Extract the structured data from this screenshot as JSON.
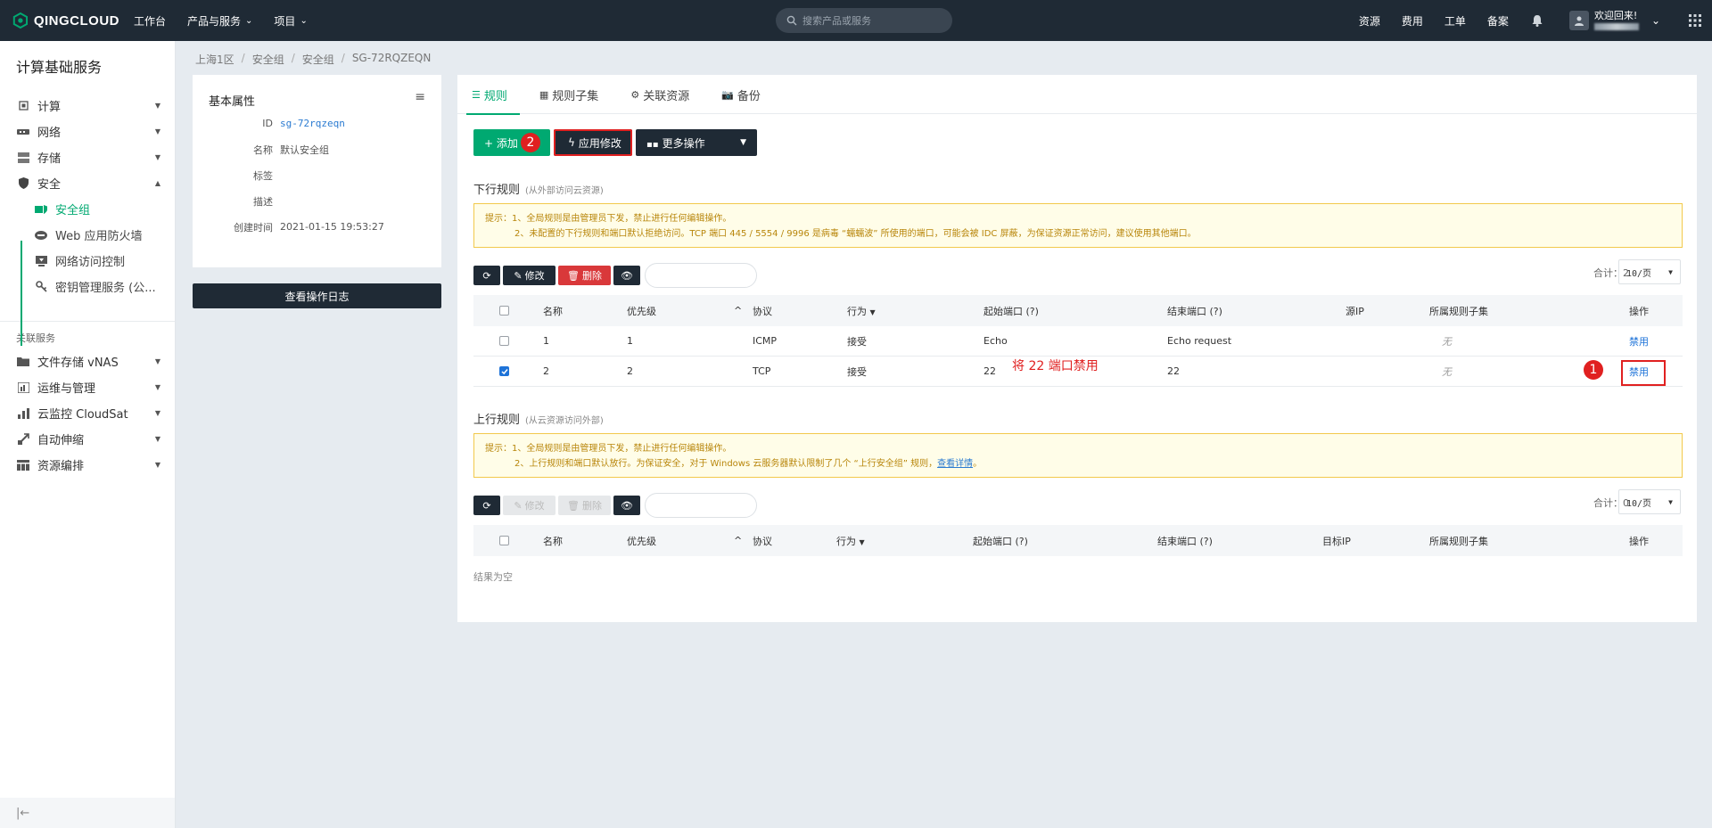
{
  "topbar": {
    "brand": "QINGCLOUD",
    "nav": [
      {
        "label": "工作台",
        "has_menu": false
      },
      {
        "label": "产品与服务",
        "has_menu": true
      },
      {
        "label": "项目",
        "has_menu": true
      }
    ],
    "search_placeholder": "搜索产品或服务",
    "right_links": [
      "资源",
      "费用",
      "工单",
      "备案"
    ],
    "welcome": "欢迎回来!"
  },
  "sidebar": {
    "title": "计算基础服务",
    "items": [
      {
        "label": "计算",
        "icon": "cpu-icon",
        "expanded": false
      },
      {
        "label": "网络",
        "icon": "network-icon",
        "expanded": false
      },
      {
        "label": "存储",
        "icon": "storage-icon",
        "expanded": false
      },
      {
        "label": "安全",
        "icon": "shield-icon",
        "expanded": true
      }
    ],
    "security_sub": [
      {
        "label": "安全组",
        "icon": "security-group-icon",
        "active": true
      },
      {
        "label": "Web 应用防火墙",
        "icon": "firewall-icon",
        "active": false
      },
      {
        "label": "网络访问控制",
        "icon": "access-control-icon",
        "active": false
      },
      {
        "label": "密钥管理服务 (公...",
        "icon": "key-icon",
        "active": false
      }
    ],
    "section_label": "关联服务",
    "related": [
      {
        "label": "文件存储 vNAS",
        "icon": "folder-icon"
      },
      {
        "label": "运维与管理",
        "icon": "ops-icon"
      },
      {
        "label": "云监控 CloudSat",
        "icon": "monitor-icon"
      },
      {
        "label": "自动伸缩",
        "icon": "autoscale-icon"
      },
      {
        "label": "资源编排",
        "icon": "orchestration-icon"
      }
    ],
    "collapse_label": "|←"
  },
  "breadcrumb": [
    "上海1区",
    "安全组",
    "安全组",
    "SG-72RQZEQN"
  ],
  "info": {
    "title": "基本属性",
    "fields": [
      {
        "key": "ID",
        "value": "sg-72rqzeqn"
      },
      {
        "key": "名称",
        "value": "默认安全组"
      },
      {
        "key": "标签",
        "value": ""
      },
      {
        "key": "描述",
        "value": ""
      },
      {
        "key": "创建时间",
        "value": "2021-01-15 19:53:27"
      }
    ],
    "log_button": "查看操作日志"
  },
  "tabs": [
    {
      "label": "规则",
      "icon": "list-icon",
      "active": true
    },
    {
      "label": "规则子集",
      "icon": "grid-icon",
      "active": false
    },
    {
      "label": "关联资源",
      "icon": "gear-icon",
      "active": false
    },
    {
      "label": "备份",
      "icon": "camera-icon",
      "active": false
    }
  ],
  "actions": {
    "add": "+ 添加",
    "apply": "应用修改",
    "more": "更多操作",
    "badge_apply": "2",
    "badge_disable": "1",
    "annotation": "将 22 端口禁用"
  },
  "downstream": {
    "title": "下行规则",
    "subtitle": "(从外部访问云资源)",
    "notice_l1": "提示：1、全局规则是由管理员下发，禁止进行任何编辑操作。",
    "notice_l2": "2、未配置的下行规则和端口默认拒绝访问。TCP 端口 445 / 5554 / 9996 是病毒 “蠕蠕波” 所使用的端口，可能会被 IDC 屏蔽，为保证资源正常访问，建议使用其他端口。",
    "edit": "修改",
    "delete": "删除",
    "total": "合计：2",
    "page_size": "10/页",
    "columns": [
      "名称",
      "优先级",
      "协议",
      "行为",
      "起始端口 (?)",
      "结束端口 (?)",
      "源IP",
      "所属规则子集",
      "操作"
    ],
    "rows": [
      {
        "name": "1",
        "priority": "1",
        "protocol": "ICMP",
        "action": "接受",
        "start": "Echo",
        "end": "Echo request",
        "ip": "",
        "subset": "无",
        "op": "禁用",
        "checked": false
      },
      {
        "name": "2",
        "priority": "2",
        "protocol": "TCP",
        "action": "接受",
        "start": "22",
        "end": "22",
        "ip": "",
        "subset": "无",
        "op": "禁用",
        "checked": true
      }
    ]
  },
  "upstream": {
    "title": "上行规则",
    "subtitle": "(从云资源访问外部)",
    "notice_l1": "提示：1、全局规则是由管理员下发，禁止进行任何编辑操作。",
    "notice_l2": "2、上行规则和端口默认放行。为保证安全，对于 Windows 云服务器默认限制了几个 “上行安全组” 规则，",
    "notice_link": "查看详情",
    "notice_tail": "。",
    "edit": "修改",
    "delete": "删除",
    "total": "合计：0",
    "page_size": "10/页",
    "columns": [
      "名称",
      "优先级",
      "协议",
      "行为",
      "起始端口 (?)",
      "结束端口 (?)",
      "目标IP",
      "所属规则子集",
      "操作"
    ],
    "empty": "结果为空"
  },
  "colors": {
    "accent": "#00a971",
    "dark": "#1f2a35",
    "danger": "#d9383a",
    "annotation": "#e02020",
    "link": "#1e73d8"
  }
}
